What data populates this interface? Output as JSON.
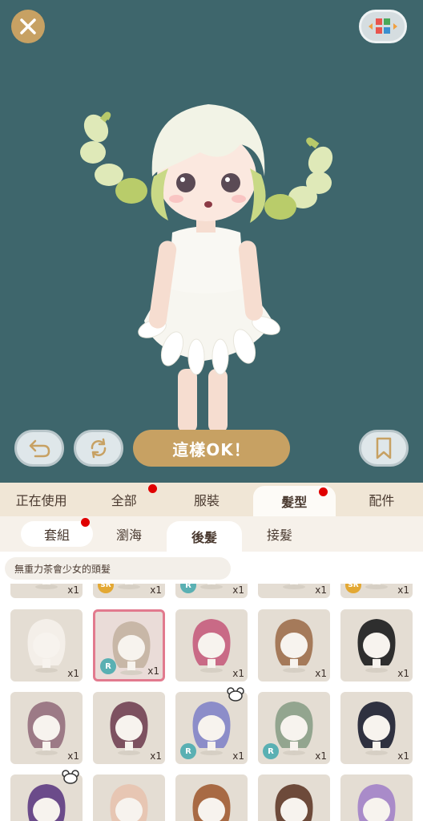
{
  "toolbar": {
    "ok_label": "這樣OK！"
  },
  "categories": [
    {
      "label": "正在使用",
      "active": false,
      "dot": false
    },
    {
      "label": "全部",
      "active": false,
      "dot": true
    },
    {
      "label": "服裝",
      "active": false,
      "dot": false
    },
    {
      "label": "髮型",
      "active": true,
      "dot": true
    },
    {
      "label": "配件",
      "active": false,
      "dot": false
    }
  ],
  "subcategories": [
    {
      "label": "套組",
      "dot": true
    },
    {
      "label": "瀏海",
      "dot": false
    },
    {
      "label": "後髮",
      "dot": false,
      "active": true
    },
    {
      "label": "接髮",
      "dot": false
    }
  ],
  "item_title": "無重力茶會少女的頭髮",
  "items": [
    {
      "qty": "x1",
      "badge": "",
      "hair": "#f1ece6"
    },
    {
      "qty": "x1",
      "badge": "SR",
      "hair": "#2a2a2a"
    },
    {
      "qty": "x1",
      "badge": "R",
      "hair": "#e8e3dd"
    },
    {
      "qty": "x1",
      "badge": "",
      "hair": "#e8e3dd"
    },
    {
      "qty": "x1",
      "badge": "SR",
      "hair": "#efe9e0"
    },
    {
      "qty": "x1",
      "badge": "",
      "hair": "#f4efe9"
    },
    {
      "qty": "x1",
      "badge": "R",
      "hair": "#c8b7a7",
      "selected": true
    },
    {
      "qty": "x1",
      "badge": "",
      "hair": "#c96a86"
    },
    {
      "qty": "x1",
      "badge": "",
      "hair": "#a57a5a"
    },
    {
      "qty": "x1",
      "badge": "",
      "hair": "#2e2e2e"
    },
    {
      "qty": "x1",
      "badge": "",
      "hair": "#9c7a86"
    },
    {
      "qty": "x1",
      "badge": "",
      "hair": "#7d5160"
    },
    {
      "qty": "x1",
      "badge": "R",
      "hair": "#8c8dc9",
      "bear": true
    },
    {
      "qty": "x1",
      "badge": "R",
      "hair": "#93a58f"
    },
    {
      "qty": "x1",
      "badge": "",
      "hair": "#2f3140"
    },
    {
      "qty": "",
      "badge": "",
      "hair": "#6b4b8a",
      "bear": true
    },
    {
      "qty": "",
      "badge": "",
      "hair": "#e7c6b3"
    },
    {
      "qty": "",
      "badge": "",
      "hair": "#a86a44"
    },
    {
      "qty": "",
      "badge": "",
      "hair": "#6d4a3a"
    },
    {
      "qty": "",
      "badge": "",
      "hair": "#a98bc9"
    }
  ],
  "colors": {
    "stage": "#3e666c",
    "accent": "#c7a163",
    "alert": "#e00000",
    "selected_border": "#e27a8e"
  }
}
